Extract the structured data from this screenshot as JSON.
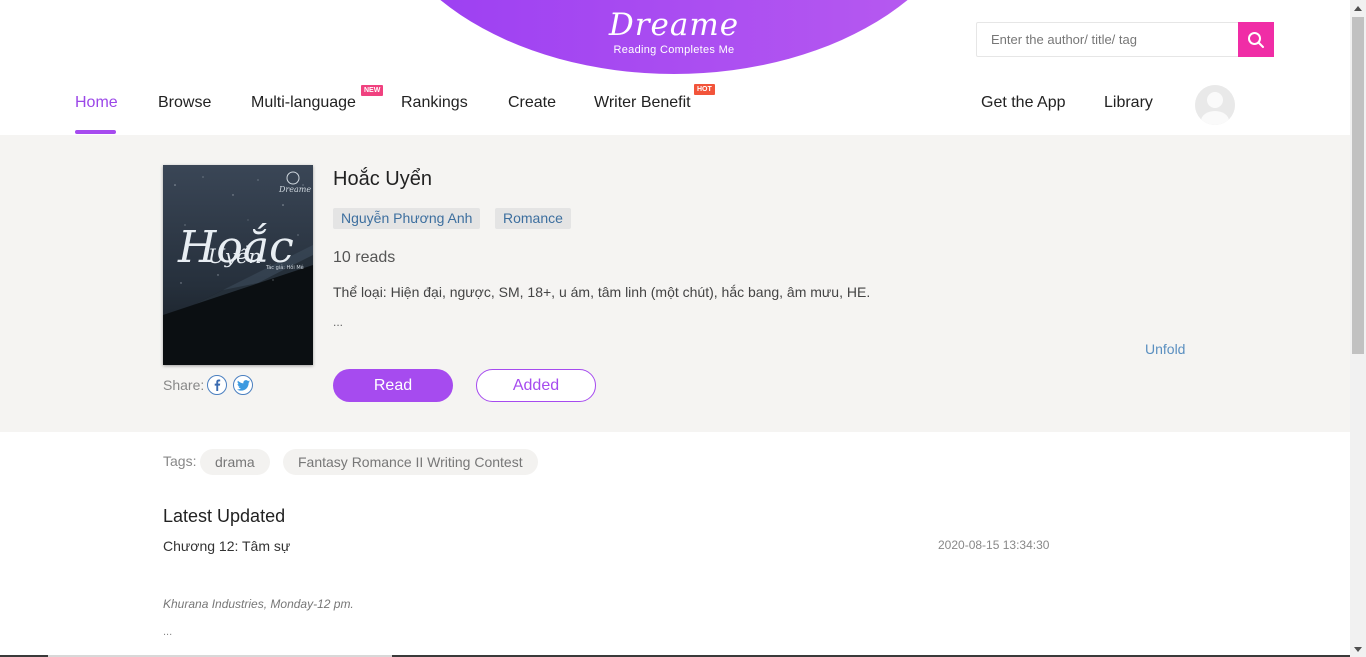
{
  "brand": {
    "title": "Dreame",
    "tagline": "Reading Completes Me",
    "accent": "#a64bef",
    "search_accent": "#f02da6"
  },
  "search": {
    "placeholder": "Enter the author/ title/ tag",
    "icon": "search-icon"
  },
  "nav": {
    "home": "Home",
    "browse": "Browse",
    "multi_language": "Multi-language",
    "multi_language_badge": "NEW",
    "rankings": "Rankings",
    "create": "Create",
    "writer_benefit": "Writer Benefit",
    "writer_benefit_badge": "HOT",
    "get_app": "Get the App",
    "library": "Library",
    "active": "Home"
  },
  "book": {
    "title": "Hoắc Uyển",
    "author": "Nguyễn Phương Anh",
    "genre": "Romance",
    "reads": "10 reads",
    "description": "Thể loại: Hiện đại, ngược, SM, 18+, u ám, tâm linh (một chút), hắc bang, âm mưu, HE.",
    "description_more": "...",
    "unfold": "Unfold",
    "share_label": "Share:",
    "read_button": "Read",
    "added_button": "Added",
    "cover": {
      "script_line1": "Hoắc",
      "script_line2": "Uyển",
      "caption": "Tác giả: Hồi Mê",
      "brand": "Dreame"
    }
  },
  "tags": {
    "label": "Tags:",
    "items": [
      "drama",
      "Fantasy Romance II Writing Contest"
    ]
  },
  "latest": {
    "heading": "Latest Updated",
    "chapter": "Chương 12: Tâm sự",
    "date": "2020-08-15 13:34:30",
    "excerpt": "Khurana Industries, Monday-12 pm.",
    "excerpt_more": "..."
  }
}
